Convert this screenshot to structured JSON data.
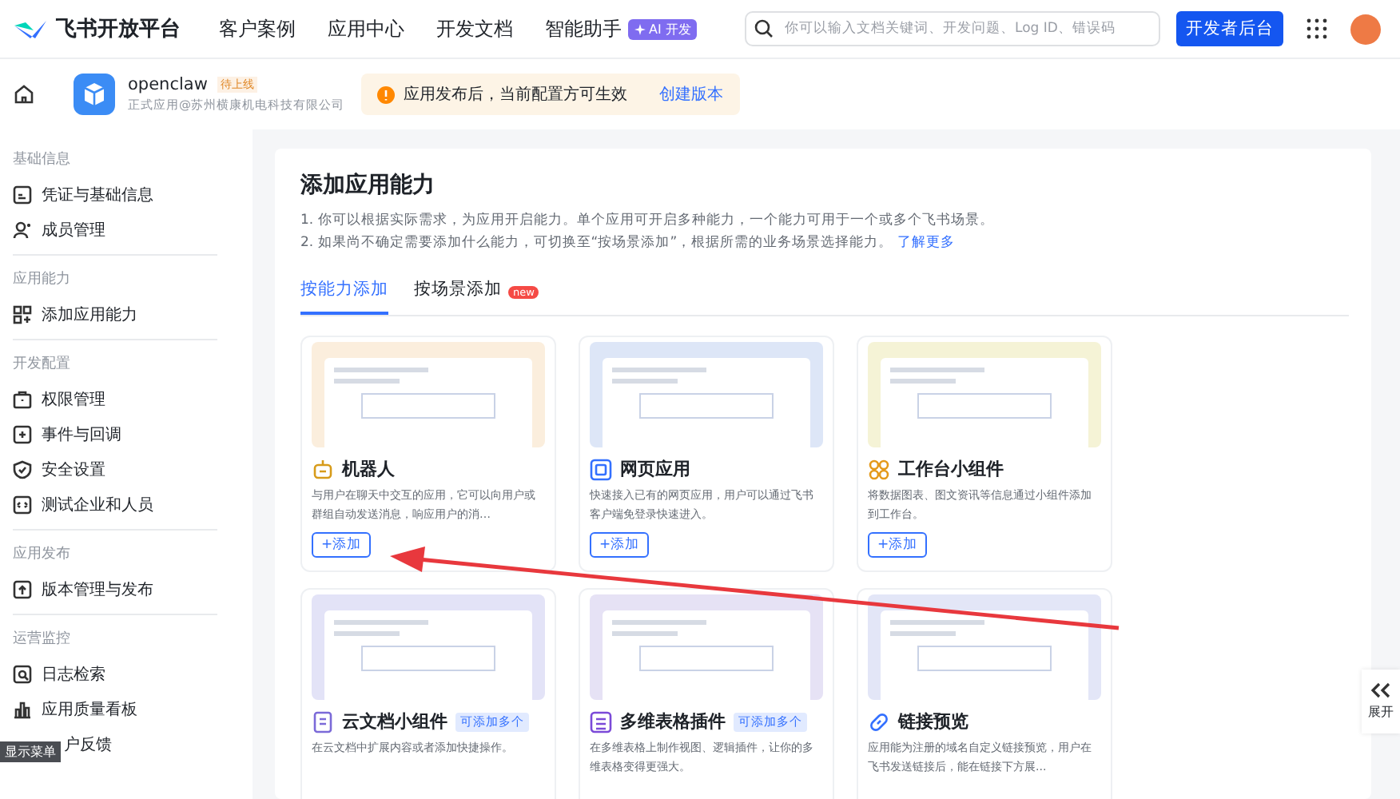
{
  "top_nav": {
    "logo_text": "飞书开放平台",
    "links": [
      "客户案例",
      "应用中心",
      "开发文档",
      "智能助手"
    ],
    "ai_badge": "AI 开发",
    "search": {
      "placeholder": "你可以输入文档关键词、开发问题、Log ID、错误码"
    },
    "console_button": "开发者后台"
  },
  "app_bar": {
    "name": "openclaw",
    "status": "待上线",
    "subtitle": "正式应用@苏州横康机电科技有限公司",
    "notice": "应用发布后，当前配置方可生效",
    "notice_link": "创建版本"
  },
  "sidebar": [
    {
      "title": "基础信息",
      "items": [
        "凭证与基础信息",
        "成员管理"
      ]
    },
    {
      "title": "应用能力",
      "items": [
        "添加应用能力"
      ]
    },
    {
      "title": "开发配置",
      "items": [
        "权限管理",
        "事件与回调",
        "安全设置",
        "测试企业和人员"
      ]
    },
    {
      "title": "应用发布",
      "items": [
        "版本管理与发布"
      ]
    },
    {
      "title": "运营监控",
      "items": [
        "日志检索",
        "应用质量看板",
        "户反馈"
      ]
    }
  ],
  "menu_tooltip": "显示菜单",
  "content": {
    "title": "添加应用能力",
    "notes": [
      "1. 你可以根据实际需求，为应用开启能力。单个应用可开启多种能力，一个能力可用于一个或多个飞书场景。",
      "2. 如果尚不确定需要添加什么能力，可切换至“按场景添加”，根据所需的业务场景选择能力。"
    ],
    "learn_more": "了解更多",
    "tabs": [
      {
        "label": "按能力添加",
        "selected": true
      },
      {
        "label": "按场景添加",
        "selected": false,
        "badge": "new"
      }
    ],
    "cards": [
      {
        "title": "机器人",
        "description": "与用户在聊天中交互的应用，它可以向用户或群组自动发送消息，响应用户的消…",
        "add_button": "+添加"
      },
      {
        "title": "网页应用",
        "description": "快速接入已有的网页应用，用户可以通过飞书客户端免登录快速进入。",
        "add_button": "+添加"
      },
      {
        "title": "工作台小组件",
        "description": "将数据图表、图文资讯等信息通过小组件添加到工作台。",
        "add_button": "+添加"
      },
      {
        "title": "云文档小组件",
        "badge": "可添加多个",
        "description": "在云文档中扩展内容或者添加快捷操作。"
      },
      {
        "title": "多维表格插件",
        "badge": "可添加多个",
        "description": "在多维表格上制作视图、逻辑插件，让你的多维表格变得更强大。"
      },
      {
        "title": "链接预览",
        "description": "应用能为注册的域名自定义链接预览，用户在飞书发送链接后，能在链接下方展..."
      }
    ]
  },
  "expand_button": "展开"
}
